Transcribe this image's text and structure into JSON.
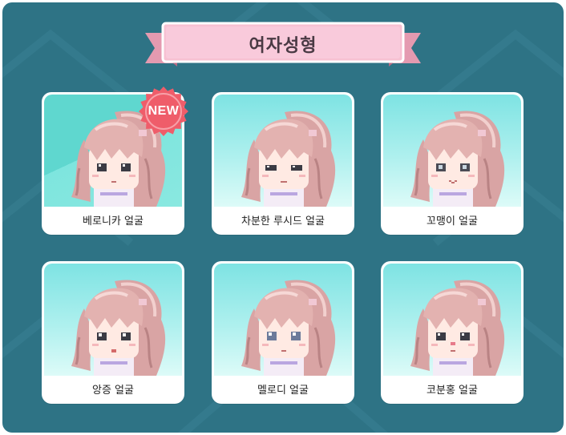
{
  "header": {
    "title": "여자성형"
  },
  "badge": {
    "label": "NEW"
  },
  "colors": {
    "panel_bg": "#2e7385",
    "ribbon": "#f7c1d2",
    "card_bg": "#ffffff",
    "art_sky": "#aef0ee",
    "art_selected": "#5fd7cf",
    "hair": "#d9a4a4",
    "badge": "#ef5d6a"
  },
  "faces": [
    {
      "label": "베로니카 얼굴",
      "selected": true,
      "is_new": true
    },
    {
      "label": "차분한 루시드 얼굴",
      "selected": false,
      "is_new": false
    },
    {
      "label": "꼬맹이 얼굴",
      "selected": false,
      "is_new": false
    },
    {
      "label": "앙증 얼굴",
      "selected": false,
      "is_new": false
    },
    {
      "label": "멜로디 얼굴",
      "selected": false,
      "is_new": false
    },
    {
      "label": "코분홍 얼굴",
      "selected": false,
      "is_new": false
    }
  ]
}
